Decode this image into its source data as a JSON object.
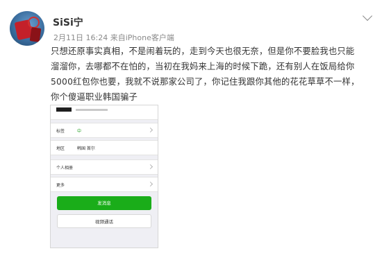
{
  "post": {
    "author": "SiSi宁",
    "date": "2月11日 16:24",
    "source_prefix": "来自",
    "source": "iPhone客户端",
    "text_lines": [
      "只想还原事实真相，不是闹着玩的，走到今天也很无奈，但是你不要脸我也只能",
      "溜溜你，去哪都不在怕的，当初在我妈来上海的时候下跪，还有别人在饭局给你",
      "5000红包你也要，我就不说那家公司了，你记住我跟你其他的花花草草不一样，",
      "你个傻逼职业韩国骗子"
    ]
  },
  "screenshot": {
    "rows": [
      {
        "label": "标签",
        "value": "中"
      },
      {
        "label": "地区",
        "value": "韩国 首尔"
      },
      {
        "label": "个人相册",
        "value": ""
      },
      {
        "label": "更多",
        "value": ""
      }
    ],
    "send_message_label": "发消息",
    "video_call_label": "视频通话"
  },
  "colors": {
    "send_button": "#1aad19",
    "text": "#333333",
    "meta": "#8a8a8a"
  }
}
